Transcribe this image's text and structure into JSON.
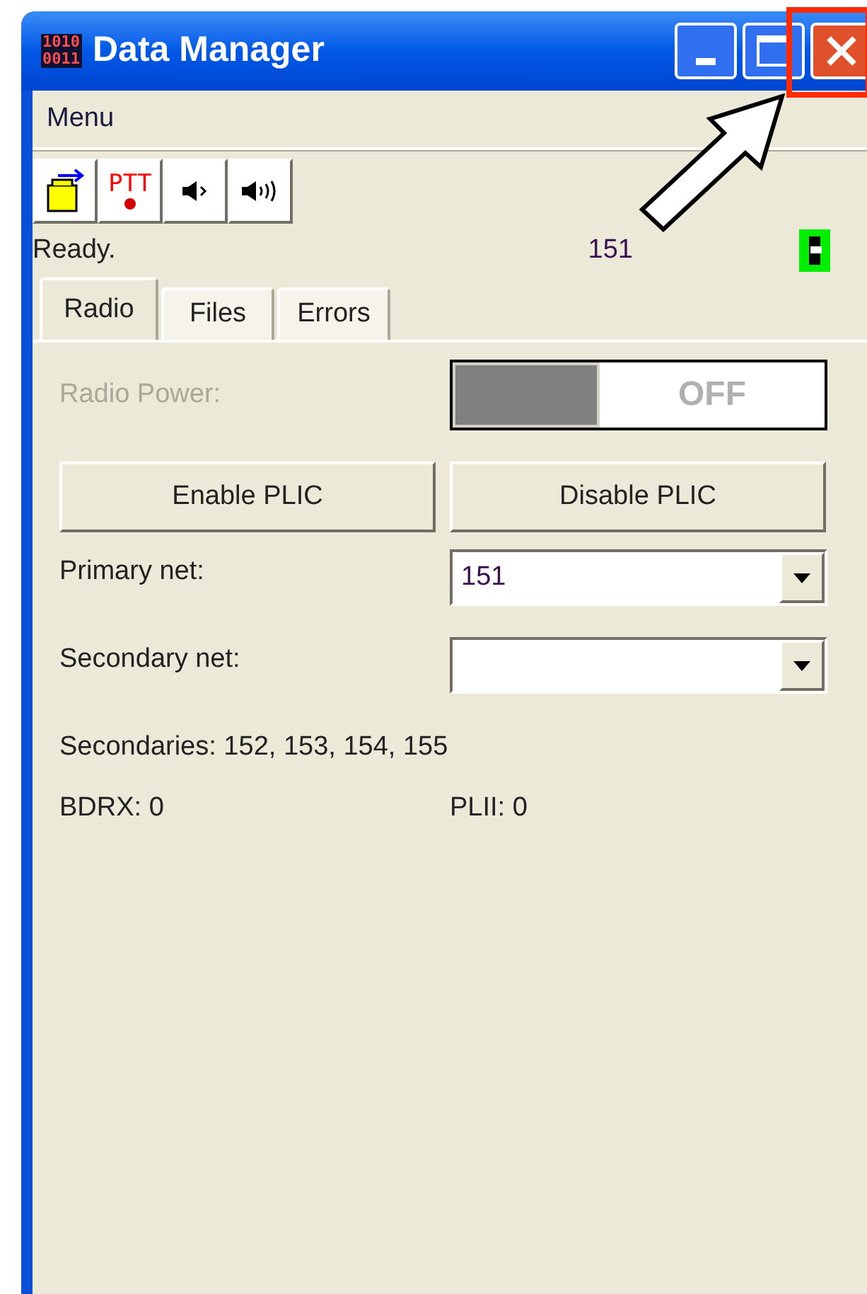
{
  "window": {
    "title": "Data Manager",
    "icon_text": [
      "1010",
      "0011"
    ]
  },
  "menu_bar": {
    "items": [
      "Menu"
    ]
  },
  "toolbar": {
    "buttons": [
      {
        "kind": "open"
      },
      {
        "kind": "ptt",
        "text": "PTT"
      },
      {
        "kind": "speaker"
      },
      {
        "kind": "speaker_loud"
      }
    ]
  },
  "status": {
    "text": "Ready.",
    "net": "151"
  },
  "tabs": [
    {
      "label": "Radio",
      "selected": true
    },
    {
      "label": "Files",
      "selected": false
    },
    {
      "label": "Errors",
      "selected": false
    }
  ],
  "radio": {
    "power": {
      "label": "Radio Power:",
      "disabled": true,
      "on": false,
      "state_text": "OFF"
    },
    "buttons": [
      "Enable PLIC",
      "Disable PLIC"
    ],
    "primary_net": {
      "label": "Primary net:",
      "value": "151"
    },
    "secondary_net": {
      "label": "Secondary net:"
    },
    "secondaries": "Secondaries: 152, 153, 154, 155",
    "bdrx": "BDRX: 0",
    "plii": "PLII: 0"
  },
  "annotation": {
    "highlight_close": true
  }
}
